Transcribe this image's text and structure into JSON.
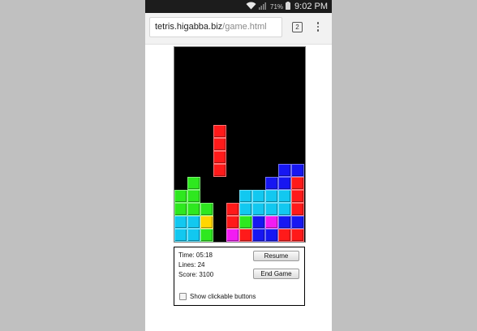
{
  "status_bar": {
    "wifi_icon": "wifi-icon",
    "signal_icon": "signal-icon",
    "battery_icon": "battery-icon",
    "battery_percent": "71%",
    "time": "9:02 PM"
  },
  "browser": {
    "url_host": "tetris.higabba.biz",
    "url_path": "/game.html",
    "tab_count": "2",
    "menu_icon": "more-vert-icon"
  },
  "game": {
    "colors": {
      "red": "#ff1a1a",
      "green": "#2ee81f",
      "cyan": "#12c8f0",
      "blue": "#1717f2",
      "yellow": "#ffd600",
      "magenta": "#f21cf2"
    },
    "board_cells_description_rows": [
      "r6-r9: falling red I piece in column 3",
      "r8-r14: stacked pieces"
    ],
    "board": [
      {
        "r": 6,
        "c": 3,
        "k": "red"
      },
      {
        "r": 7,
        "c": 3,
        "k": "red"
      },
      {
        "r": 8,
        "c": 3,
        "k": "red"
      },
      {
        "r": 9,
        "c": 3,
        "k": "red"
      },
      {
        "r": 9,
        "c": 8,
        "k": "blue"
      },
      {
        "r": 9,
        "c": 9,
        "k": "blue"
      },
      {
        "r": 10,
        "c": 1,
        "k": "green"
      },
      {
        "r": 10,
        "c": 7,
        "k": "blue"
      },
      {
        "r": 10,
        "c": 8,
        "k": "blue"
      },
      {
        "r": 10,
        "c": 9,
        "k": "red"
      },
      {
        "r": 11,
        "c": 0,
        "k": "green"
      },
      {
        "r": 11,
        "c": 1,
        "k": "green"
      },
      {
        "r": 11,
        "c": 5,
        "k": "cyan"
      },
      {
        "r": 11,
        "c": 6,
        "k": "cyan"
      },
      {
        "r": 11,
        "c": 7,
        "k": "cyan"
      },
      {
        "r": 11,
        "c": 8,
        "k": "cyan"
      },
      {
        "r": 11,
        "c": 9,
        "k": "red"
      },
      {
        "r": 12,
        "c": 0,
        "k": "green"
      },
      {
        "r": 12,
        "c": 1,
        "k": "green"
      },
      {
        "r": 12,
        "c": 2,
        "k": "green"
      },
      {
        "r": 12,
        "c": 4,
        "k": "red"
      },
      {
        "r": 12,
        "c": 5,
        "k": "cyan"
      },
      {
        "r": 12,
        "c": 6,
        "k": "cyan"
      },
      {
        "r": 12,
        "c": 7,
        "k": "cyan"
      },
      {
        "r": 12,
        "c": 8,
        "k": "cyan"
      },
      {
        "r": 12,
        "c": 9,
        "k": "red"
      },
      {
        "r": 13,
        "c": 0,
        "k": "cyan"
      },
      {
        "r": 13,
        "c": 1,
        "k": "cyan"
      },
      {
        "r": 13,
        "c": 2,
        "k": "yellow"
      },
      {
        "r": 13,
        "c": 4,
        "k": "red"
      },
      {
        "r": 13,
        "c": 5,
        "k": "green"
      },
      {
        "r": 13,
        "c": 6,
        "k": "blue"
      },
      {
        "r": 13,
        "c": 7,
        "k": "magenta"
      },
      {
        "r": 13,
        "c": 8,
        "k": "blue"
      },
      {
        "r": 13,
        "c": 9,
        "k": "blue"
      },
      {
        "r": 14,
        "c": 0,
        "k": "cyan"
      },
      {
        "r": 14,
        "c": 1,
        "k": "cyan"
      },
      {
        "r": 14,
        "c": 2,
        "k": "green"
      },
      {
        "r": 14,
        "c": 4,
        "k": "magenta"
      },
      {
        "r": 14,
        "c": 5,
        "k": "red"
      },
      {
        "r": 14,
        "c": 6,
        "k": "blue"
      },
      {
        "r": 14,
        "c": 7,
        "k": "blue"
      },
      {
        "r": 14,
        "c": 8,
        "k": "red"
      },
      {
        "r": 14,
        "c": 9,
        "k": "red"
      }
    ]
  },
  "panel": {
    "time_text": "Time: 05:18",
    "lines_text": "Lines: 24",
    "score_text": "Score: 3100",
    "resume_label": "Resume",
    "end_game_label": "End Game",
    "checkbox_label": "Show clickable buttons",
    "checkbox_checked": false
  }
}
